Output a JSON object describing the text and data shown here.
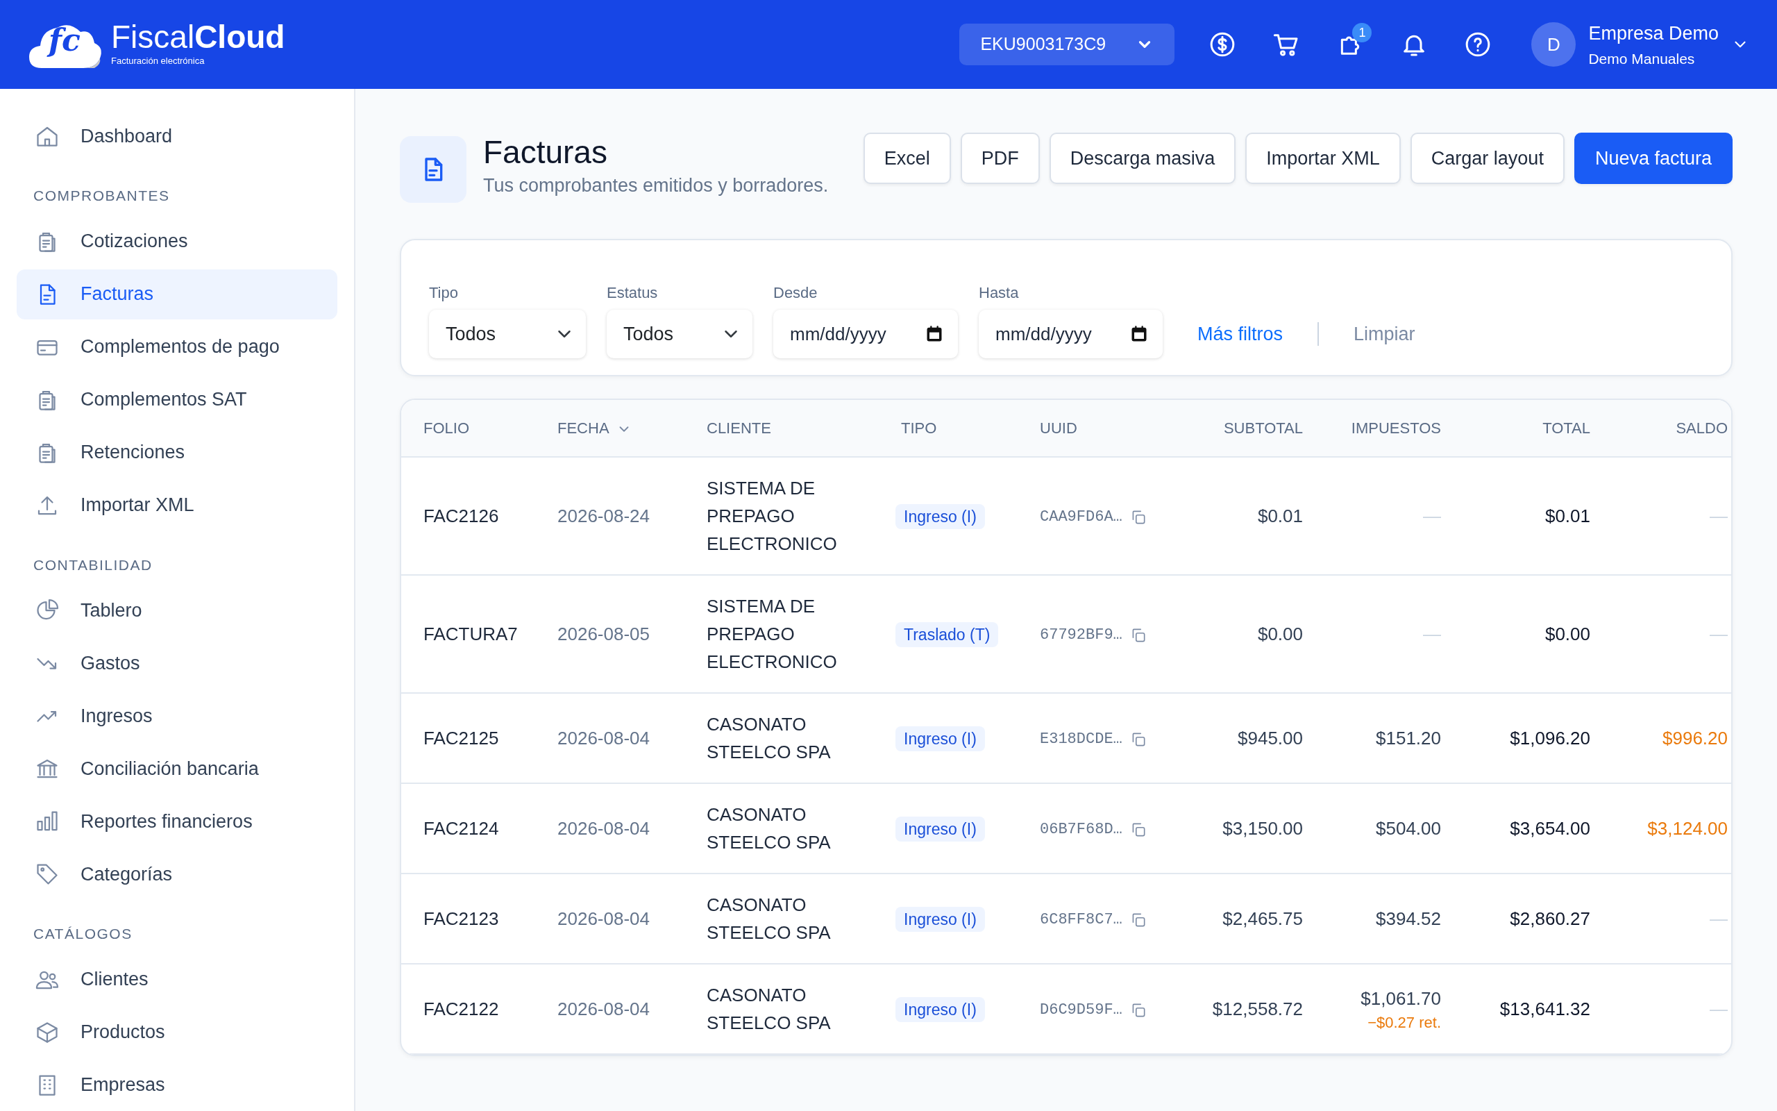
{
  "header": {
    "logo": {
      "mark": "fc",
      "name_regular": "Fiscal",
      "name_bold": "Cloud",
      "tagline": "Facturación electrónica"
    },
    "rfc_select": "EKU9003173C9",
    "notification_badge": "1",
    "user": {
      "initial": "D",
      "name": "Empresa Demo",
      "subtitle": "Demo Manuales"
    }
  },
  "sidebar": {
    "sections": [
      {
        "items": [
          {
            "label": "Dashboard",
            "selected": false
          }
        ]
      },
      {
        "title": "COMPROBANTES",
        "items": [
          {
            "label": "Cotizaciones",
            "selected": false
          },
          {
            "label": "Facturas",
            "selected": true
          },
          {
            "label": "Complementos de pago",
            "selected": false
          },
          {
            "label": "Complementos SAT",
            "selected": false
          },
          {
            "label": "Retenciones",
            "selected": false
          },
          {
            "label": "Importar XML",
            "selected": false
          }
        ]
      },
      {
        "title": "CONTABILIDAD",
        "items": [
          {
            "label": "Tablero",
            "selected": false
          },
          {
            "label": "Gastos",
            "selected": false
          },
          {
            "label": "Ingresos",
            "selected": false
          },
          {
            "label": "Conciliación bancaria",
            "selected": false
          },
          {
            "label": "Reportes financieros",
            "selected": false
          },
          {
            "label": "Categorías",
            "selected": false
          }
        ]
      },
      {
        "title": "CATÁLOGOS",
        "items": [
          {
            "label": "Clientes",
            "selected": false
          },
          {
            "label": "Productos",
            "selected": false
          },
          {
            "label": "Empresas",
            "selected": false
          }
        ]
      }
    ]
  },
  "page": {
    "title": "Facturas",
    "subtitle": "Tus comprobantes emitidos y borradores.",
    "buttons": [
      {
        "label": "Excel",
        "kind": "outline"
      },
      {
        "label": "PDF",
        "kind": "outline"
      },
      {
        "label": "Descarga masiva",
        "kind": "outline"
      },
      {
        "label": "Importar XML",
        "kind": "outline"
      },
      {
        "label": "Cargar layout",
        "kind": "outline"
      },
      {
        "label": "Nueva factura",
        "kind": "primary"
      }
    ]
  },
  "filters": {
    "fields": [
      {
        "label": "Tipo",
        "kind": "select",
        "value": "Todos"
      },
      {
        "label": "Estatus",
        "kind": "select",
        "value": "Todos"
      },
      {
        "label": "Desde",
        "kind": "date",
        "placeholder": "mm/dd/yyyy"
      },
      {
        "label": "Hasta",
        "kind": "date",
        "placeholder": "mm/dd/yyyy"
      }
    ],
    "more_link": "Más filtros",
    "clear_link": "Limpiar"
  },
  "table": {
    "columns": [
      {
        "label": "FOLIO",
        "sorted": false
      },
      {
        "label": "FECHA",
        "sorted": true
      },
      {
        "label": "CLIENTE",
        "sorted": false
      },
      {
        "label": "TIPO",
        "sorted": false
      },
      {
        "label": "UUID",
        "sorted": false
      },
      {
        "label": "SUBTOTAL",
        "sorted": false
      },
      {
        "label": "IMPUESTOS",
        "sorted": false
      },
      {
        "label": "TOTAL",
        "sorted": false
      },
      {
        "label": "SALDO",
        "sorted": false
      }
    ],
    "rows": [
      {
        "folio": "FAC2126",
        "fecha": "2026-08-24",
        "cliente": "SISTEMA DE PREPAGO ELECTRONICO",
        "tipo": "Ingreso (I)",
        "uuid": "CAA9FD6A…",
        "subtotal": "$0.01",
        "impuestos": "—",
        "total": "$0.01",
        "saldo": "—",
        "saldo_pending": false
      },
      {
        "folio": "FACTURA7",
        "fecha": "2026-08-05",
        "cliente": "SISTEMA DE PREPAGO ELECTRONICO",
        "tipo": "Traslado (T)",
        "uuid": "67792BF9…",
        "subtotal": "$0.00",
        "impuestos": "—",
        "total": "$0.00",
        "saldo": "—",
        "saldo_pending": false
      },
      {
        "folio": "FAC2125",
        "fecha": "2026-08-04",
        "cliente": "CASONATO STEELCO SPA",
        "tipo": "Ingreso (I)",
        "uuid": "E318DCDE…",
        "subtotal": "$945.00",
        "impuestos": "$151.20",
        "total": "$1,096.20",
        "saldo": "$996.20",
        "saldo_pending": true
      },
      {
        "folio": "FAC2124",
        "fecha": "2026-08-04",
        "cliente": "CASONATO STEELCO SPA",
        "tipo": "Ingreso (I)",
        "uuid": "06B7F68D…",
        "subtotal": "$3,150.00",
        "impuestos": "$504.00",
        "total": "$3,654.00",
        "saldo": "$3,124.00",
        "saldo_pending": true
      },
      {
        "folio": "FAC2123",
        "fecha": "2026-08-04",
        "cliente": "CASONATO STEELCO SPA",
        "tipo": "Ingreso (I)",
        "uuid": "6C8FF8C7…",
        "subtotal": "$2,465.75",
        "impuestos": "$394.52",
        "total": "$2,860.27",
        "saldo": "—",
        "saldo_pending": false
      },
      {
        "folio": "FAC2122",
        "fecha": "2026-08-04",
        "cliente": "CASONATO STEELCO SPA",
        "tipo": "Ingreso (I)",
        "uuid": "D6C9D59F…",
        "subtotal": "$12,558.72",
        "impuestos": "$1,061.70",
        "impuestos_note": "−$0.27 ret.",
        "total": "$13,641.32",
        "saldo": "—",
        "saldo_pending": false
      }
    ]
  }
}
